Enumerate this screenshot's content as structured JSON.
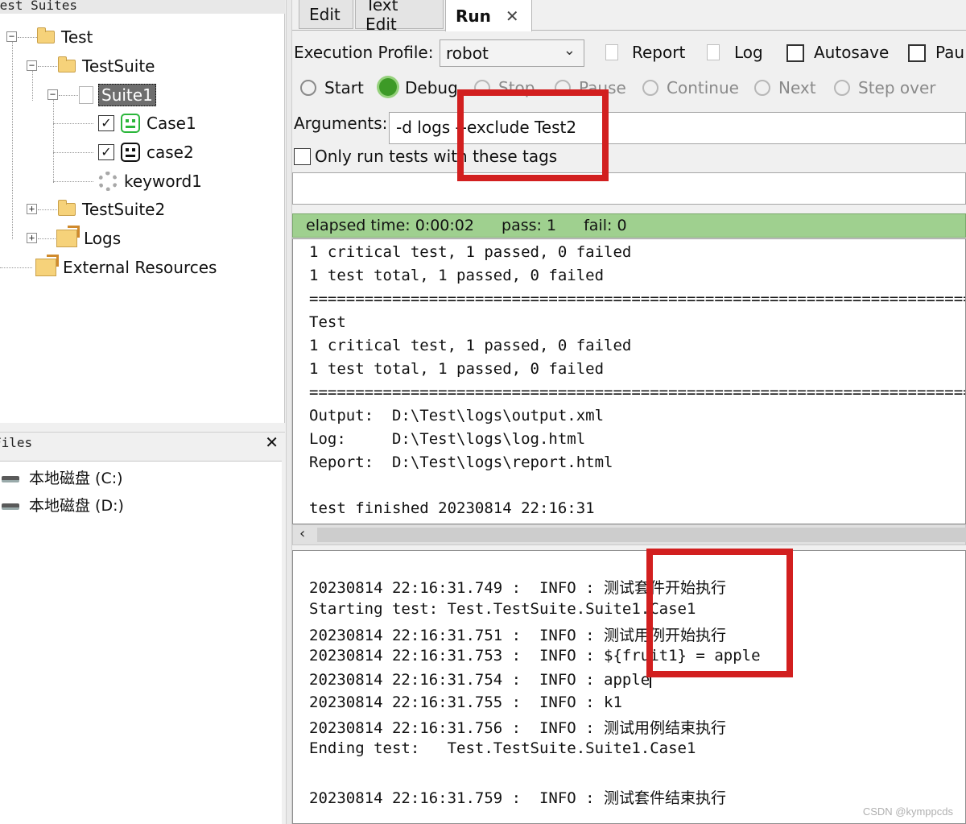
{
  "left": {
    "suites_title": "Test Suites",
    "tree": {
      "test": "Test",
      "testsuite": "TestSuite",
      "suite1": "Suite1",
      "case1": "Case1",
      "case2": "case2",
      "keyword1": "keyword1",
      "testsuite2": "TestSuite2",
      "logs": "Logs",
      "external": "External Resources"
    },
    "files_title": "Files",
    "files_close": "✕",
    "drives": [
      "本地磁盘 (C:)",
      "本地磁盘 (D:)"
    ]
  },
  "tabs": [
    {
      "label": "Edit"
    },
    {
      "label": "Text Edit"
    },
    {
      "label": "Run",
      "close": "✕"
    }
  ],
  "toolbar": {
    "profile_label": "Execution Profile:",
    "profile_value": "robot",
    "report": "Report",
    "log": "Log",
    "autosave": "Autosave",
    "pause_trunc": "Pau",
    "start": "Start",
    "debug": "Debug",
    "stop": "Stop",
    "pause": "Pause",
    "continue": "Continue",
    "next": "Next",
    "step_over": "Step over",
    "arguments_label": "Arguments:",
    "arguments_value": "-d logs --exclude Test2",
    "tags_label": "Only run tests with these tags"
  },
  "status": {
    "elapsed": "elapsed time: 0:00:02",
    "pass": "pass: 1",
    "fail": "fail: 0"
  },
  "console_lines": [
    "1 critical test, 1 passed, 0 failed",
    "1 test total, 1 passed, 0 failed",
    "==============================================================================",
    "Test",
    "1 critical test, 1 passed, 0 failed",
    "1 test total, 1 passed, 0 failed",
    "==============================================================================",
    "Output:  D:\\Test\\logs\\output.xml",
    "Log:     D:\\Test\\logs\\log.html",
    "Report:  D:\\Test\\logs\\report.html",
    "",
    "test finished 20230814 22:16:31"
  ],
  "log_lines": [
    "",
    "20230814 22:16:31.749 :  INFO : 测试套件开始执行",
    "Starting test: Test.TestSuite.Suite1.Case1",
    "20230814 22:16:31.751 :  INFO : 测试用例开始执行",
    "20230814 22:16:31.753 :  INFO : ${fruit1} = apple",
    "20230814 22:16:31.754 :  INFO : apple",
    "20230814 22:16:31.755 :  INFO : k1",
    "20230814 22:16:31.756 :  INFO : 测试用例结束执行",
    "Ending test:   Test.TestSuite.Suite1.Case1",
    "",
    "20230814 22:16:31.759 :  INFO : 测试套件结束执行"
  ],
  "watermark": "CSDN @kymppcds",
  "colors": {
    "status_green": "#9fd08f",
    "highlight_red": "#d21f1f",
    "selection_gray": "#6e6e6e"
  }
}
